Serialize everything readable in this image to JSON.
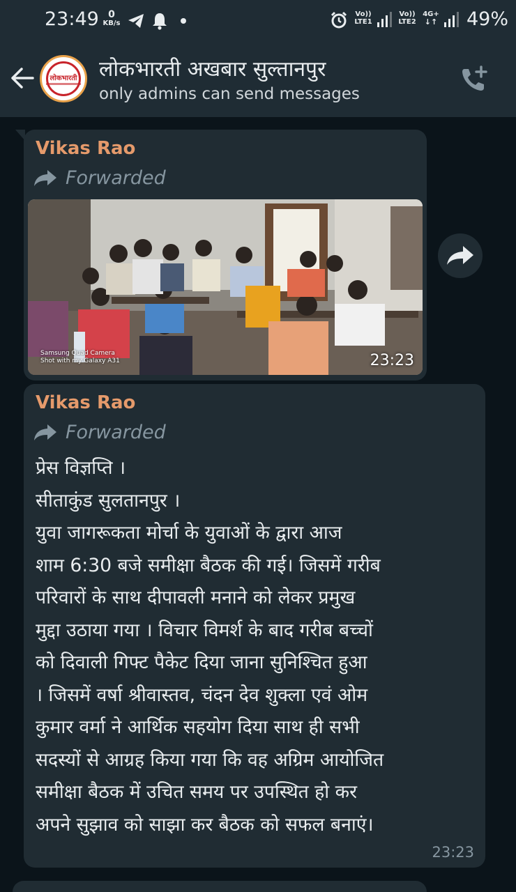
{
  "status_bar": {
    "time": "23:49",
    "speed_value": "0",
    "speed_unit": "KB/s",
    "sim1_top": "Vo))",
    "sim1_bottom": "LTE1",
    "sim2_top": "Vo))",
    "sim2_bottom": "LTE2",
    "net_type": "4G+",
    "battery": "49%"
  },
  "header": {
    "title": "लोकभारती अखबार सुल्तानपुर",
    "subtitle": "only admins can send messages",
    "avatar_logo_text": "लोकभारती"
  },
  "messages": [
    {
      "sender": "Vikas Rao",
      "forwarded_label": "Forwarded",
      "time": "23:23",
      "photo_watermark_1": "Samsung Quad Camera",
      "photo_watermark_2": "Shot with my Galaxy A31"
    },
    {
      "sender": "Vikas Rao",
      "forwarded_label": "Forwarded",
      "time": "23:23",
      "lines": [
        "प्रेस विज्ञप्ति ।",
        "सीताकुंड सुलतानपुर ।",
        "युवा जागरूकता मोर्चा के युवाओं के द्वारा आज",
        "शाम 6:30 बजे समीक्षा बैठक की गई। जिसमें गरीब",
        "परिवारों के साथ दीपावली मनाने को लेकर  प्रमुख",
        "मुद्दा उठाया गया । विचार विमर्श के बाद गरीब बच्चों",
        "को दिवाली गिफ्ट पैकेट दिया जाना सुनिश्चित हुआ",
        "। जिसमें वर्षा श्रीवास्तव, चंदन देव शुक्ला एवं ओम",
        "कुमार वर्मा ने आर्थिक सहयोग दिया साथ ही सभी",
        "सदस्यों से आग्रह किया गया कि वह अग्रिम आयोजित",
        "समीक्षा बैठक में उचित समय पर उपस्थित हो कर",
        "अपने सुझाव को साझा कर  बैठक को सफल बनाएं।"
      ]
    }
  ],
  "colors": {
    "header_bg": "#1f2c34",
    "chat_bg": "#0b141a",
    "bubble_bg": "#202c33",
    "sender": "#e59a6b",
    "meta": "#8696a0"
  }
}
